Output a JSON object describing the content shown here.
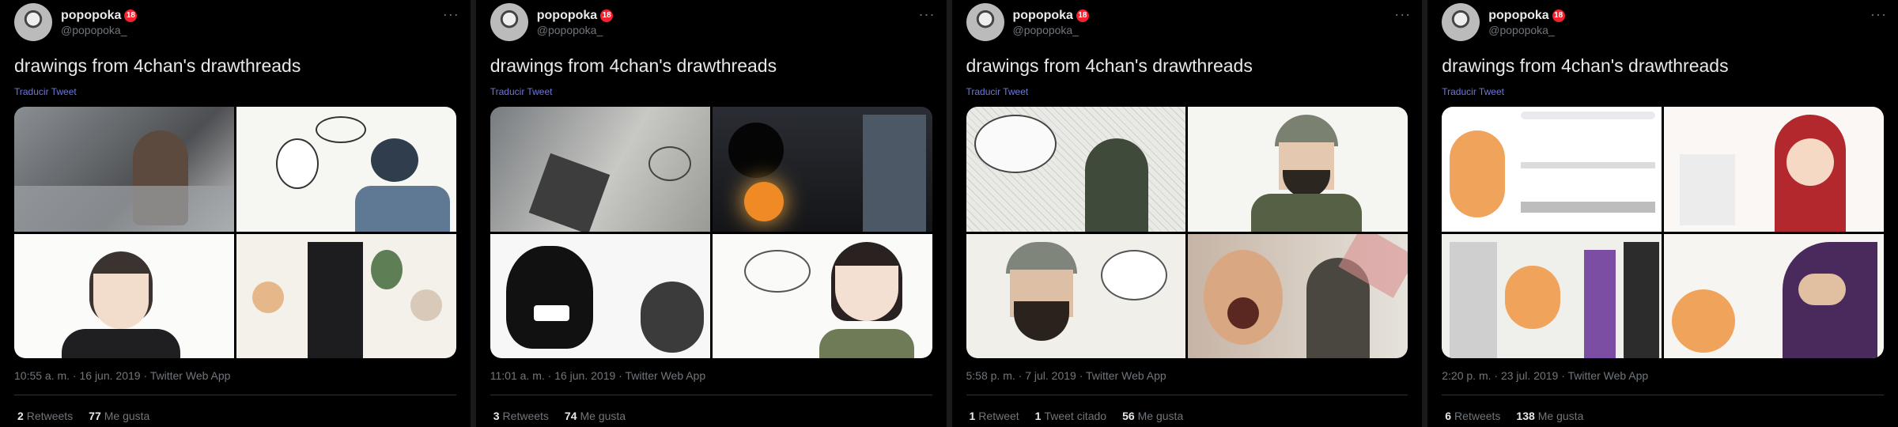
{
  "tweets": [
    {
      "display_name": "popopoka",
      "age_badge": "18",
      "handle": "@popopoka_",
      "text": "drawings from 4chan's drawthreads",
      "translate": "Traducir Tweet",
      "meta": "10:55 a. m. · 16 jun. 2019 · Twitter Web App",
      "stats": [
        {
          "count": "2",
          "label": "Retweets"
        },
        {
          "count": "77",
          "label": "Me gusta"
        }
      ]
    },
    {
      "display_name": "popopoka",
      "age_badge": "18",
      "handle": "@popopoka_",
      "text": "drawings from 4chan's drawthreads",
      "translate": "Traducir Tweet",
      "meta": "11:01 a. m. · 16 jun. 2019 · Twitter Web App",
      "stats": [
        {
          "count": "3",
          "label": "Retweets"
        },
        {
          "count": "74",
          "label": "Me gusta"
        }
      ]
    },
    {
      "display_name": "popopoka",
      "age_badge": "18",
      "handle": "@popopoka_",
      "text": "drawings from 4chan's drawthreads",
      "translate": "Traducir Tweet",
      "meta": "5:58 p. m. · 7 jul. 2019 · Twitter Web App",
      "stats": [
        {
          "count": "1",
          "label": "Retweet"
        },
        {
          "count": "1",
          "label": "Tweet citado"
        },
        {
          "count": "56",
          "label": "Me gusta"
        }
      ]
    },
    {
      "display_name": "popopoka",
      "age_badge": "18",
      "handle": "@popopoka_",
      "text": "drawings from 4chan's drawthreads",
      "translate": "Traducir Tweet",
      "meta": "2:20 p. m. · 23 jul. 2019 · Twitter Web App",
      "stats": [
        {
          "count": "6",
          "label": "Retweets"
        },
        {
          "count": "138",
          "label": "Me gusta"
        }
      ]
    }
  ],
  "colors": {
    "background": "#000000",
    "text": "#e7e9ea",
    "muted": "#71767b",
    "link": "#6e78d6",
    "badge": "#f4212e"
  }
}
